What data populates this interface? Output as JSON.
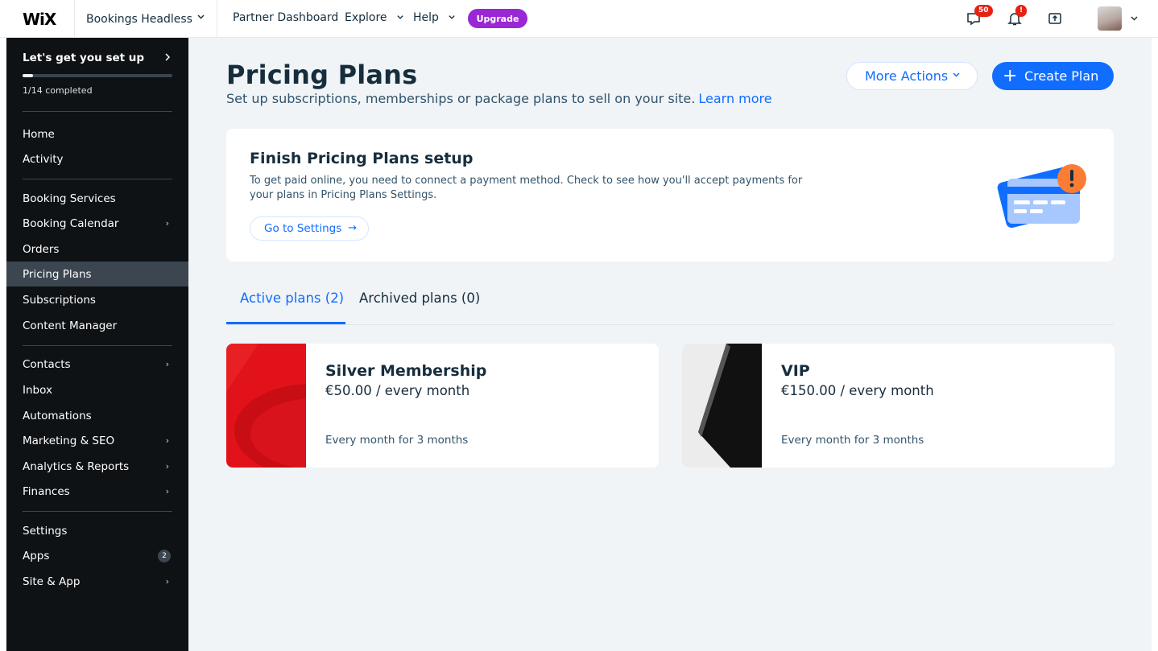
{
  "topbar": {
    "logo": "WiX",
    "site_name": "Bookings Headless",
    "nav": [
      "Partner Dashboard",
      "Explore",
      "Help"
    ],
    "upgrade_label": "Upgrade",
    "notifications": {
      "messages_badge": "50",
      "bell_badge": "!"
    }
  },
  "sidebar": {
    "setup_label": "Let's get you set up",
    "progress_fraction": 0.0714,
    "completed": "1/14 completed",
    "items": [
      {
        "label": "Home"
      },
      {
        "label": "Activity"
      },
      {
        "label": "Booking Services"
      },
      {
        "label": "Booking Calendar"
      },
      {
        "label": "Orders"
      },
      {
        "label": "Pricing Plans"
      },
      {
        "label": "Subscriptions"
      },
      {
        "label": "Content Manager"
      },
      {
        "label": "Contacts"
      },
      {
        "label": "Inbox"
      },
      {
        "label": "Automations"
      },
      {
        "label": "Marketing & SEO"
      },
      {
        "label": "Analytics & Reports"
      },
      {
        "label": "Finances"
      },
      {
        "label": "Settings"
      },
      {
        "label": "Apps",
        "count": "2"
      },
      {
        "label": "Site & App"
      }
    ]
  },
  "page": {
    "title": "Pricing Plans",
    "subtitle": "Set up subscriptions, memberships or package plans to sell on your site.",
    "learn_more": "Learn more",
    "more_actions": "More Actions",
    "create_plan": "Create Plan"
  },
  "setup_card": {
    "title": "Finish Pricing Plans setup",
    "description": "To get paid online, you need to connect a payment method. Check to see how you'll accept payments for your plans in Pricing Plans Settings.",
    "button": "Go to Settings"
  },
  "tabs": {
    "active": "Active plans (2)",
    "archived": "Archived plans (0)"
  },
  "plans": [
    {
      "name": "Silver Membership",
      "price": "€50.00 / every month",
      "duration": "Every month for 3 months"
    },
    {
      "name": "VIP",
      "price": "€150.00 / every month",
      "duration": "Every month for 3 months"
    }
  ],
  "colors": {
    "accent": "#116dff",
    "upgrade": "#9a27d5",
    "sidebar_bg": "#0e1215",
    "main_bg": "#f0f4f7"
  }
}
